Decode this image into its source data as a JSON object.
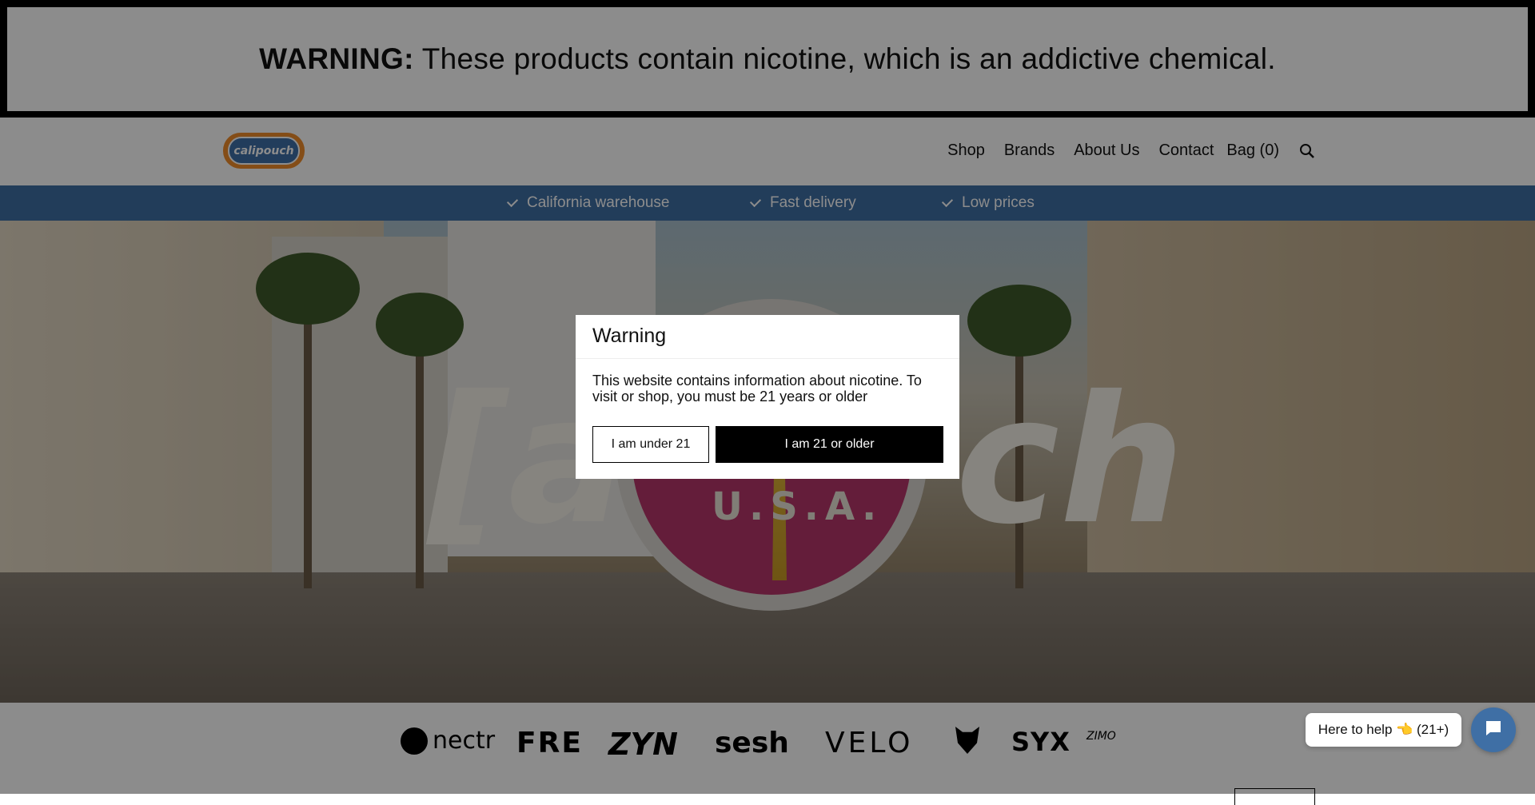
{
  "warning_banner": {
    "label": "WARNING:",
    "text": "These products contain nicotine, which is an addictive chemical."
  },
  "header": {
    "logo_text": "calipouch",
    "nav": [
      "Shop",
      "Brands",
      "About Us",
      "Contact"
    ],
    "bag_label": "Bag (0)"
  },
  "usp": [
    "California warehouse",
    "Fast delivery",
    "Low prices"
  ],
  "hero": {
    "badge_text": "U.S.A."
  },
  "modal": {
    "title": "Warning",
    "body": "This website contains information about nicotine. To visit or shop, you must be 21 years or older",
    "under_label": "I am under 21",
    "older_label": "I am 21 or older"
  },
  "brands": [
    "nectr",
    "FRE",
    "ZYN",
    "sesh",
    "VELO",
    "SYX",
    "ZIMO"
  ],
  "chat": {
    "pill_text": "Here to help 👈 (21+)"
  },
  "colors": {
    "accent": "#3f6fa5",
    "logo_orange": "#f08c2b",
    "badge_pink": "#b7356a"
  }
}
